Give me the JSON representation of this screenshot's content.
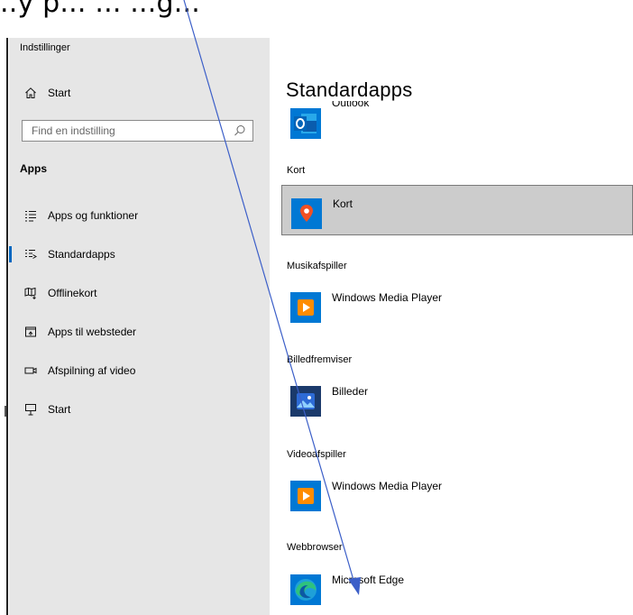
{
  "caption": {
    "text": "..y p... ... ...g..."
  },
  "window": {
    "title": "Indstillinger"
  },
  "sidebar": {
    "home_label": "Start",
    "search_placeholder": "Find en indstilling",
    "section_heading": "Apps",
    "items": [
      {
        "label": "Apps og funktioner",
        "icon": "list-icon"
      },
      {
        "label": "Standardapps",
        "icon": "default-apps-icon"
      },
      {
        "label": "Offlinekort",
        "icon": "offline-map-icon"
      },
      {
        "label": "Apps til websteder",
        "icon": "web-apps-icon"
      },
      {
        "label": "Afspilning af video",
        "icon": "video-icon"
      },
      {
        "label": "Start",
        "icon": "startup-icon"
      }
    ],
    "selected_index": 1
  },
  "main": {
    "title": "Standardapps",
    "partial_app": {
      "name": "Outlook",
      "icon": "outlook-icon"
    },
    "groups": [
      {
        "label": "Kort",
        "app": "Kort",
        "icon": "maps-pin-icon",
        "selected": true
      },
      {
        "label": "Musikafspiller",
        "app": "Windows Media Player",
        "icon": "media-player-icon",
        "selected": false
      },
      {
        "label": "Billedfremviser",
        "app": "Billeder",
        "icon": "photos-icon",
        "selected": false
      },
      {
        "label": "Videoafspiller",
        "app": "Windows Media Player",
        "icon": "media-player-icon",
        "selected": false
      },
      {
        "label": "Webbrowser",
        "app": "Microsoft Edge",
        "icon": "edge-icon",
        "selected": false
      }
    ]
  },
  "colors": {
    "sidebar_bg": "#e6e6e6",
    "accent": "#0067c0",
    "selected_row_bg": "#cccccc",
    "annotation_line": "#3c5fc8"
  }
}
